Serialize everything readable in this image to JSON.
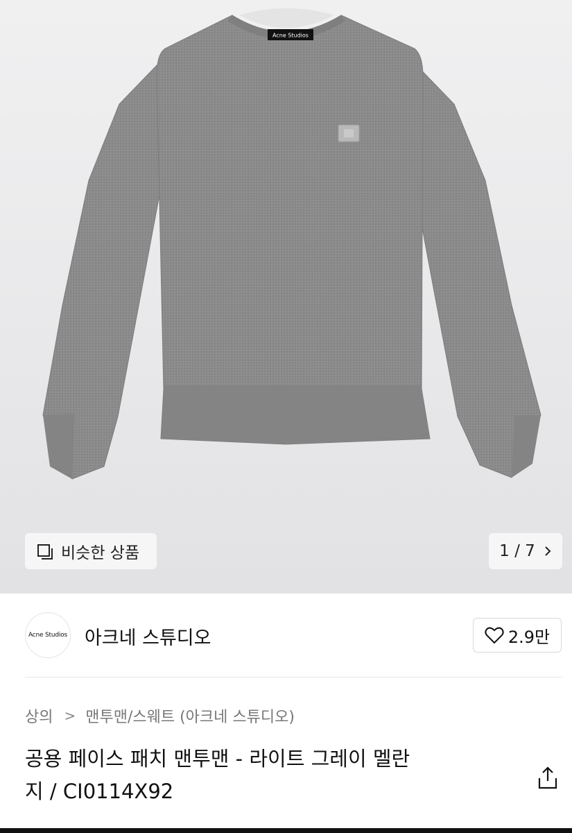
{
  "image": {
    "collar_label": "Acne Studios"
  },
  "similar": {
    "icon": "similar-products-icon",
    "label": "비슷한 상품"
  },
  "pager": {
    "text": "1 / 7",
    "icon": "chevron-right-icon"
  },
  "brand": {
    "logo_text": "Acne Studios",
    "name": "아크네 스튜디오",
    "likes": "2.9만",
    "like_icon": "heart-icon"
  },
  "breadcrumb": {
    "items": [
      "상의",
      "맨투맨/스웨트 (아크네 스튜디오)"
    ],
    "separator": ">"
  },
  "product": {
    "title_line1": "공용 페이스 패치 맨투맨 - 라이트 그레이 멜란",
    "title_line2": "지 / CI0114X92",
    "share_icon": "share-icon"
  },
  "colors": {
    "sweater": "#8a8a8a",
    "background": "#ececee"
  }
}
